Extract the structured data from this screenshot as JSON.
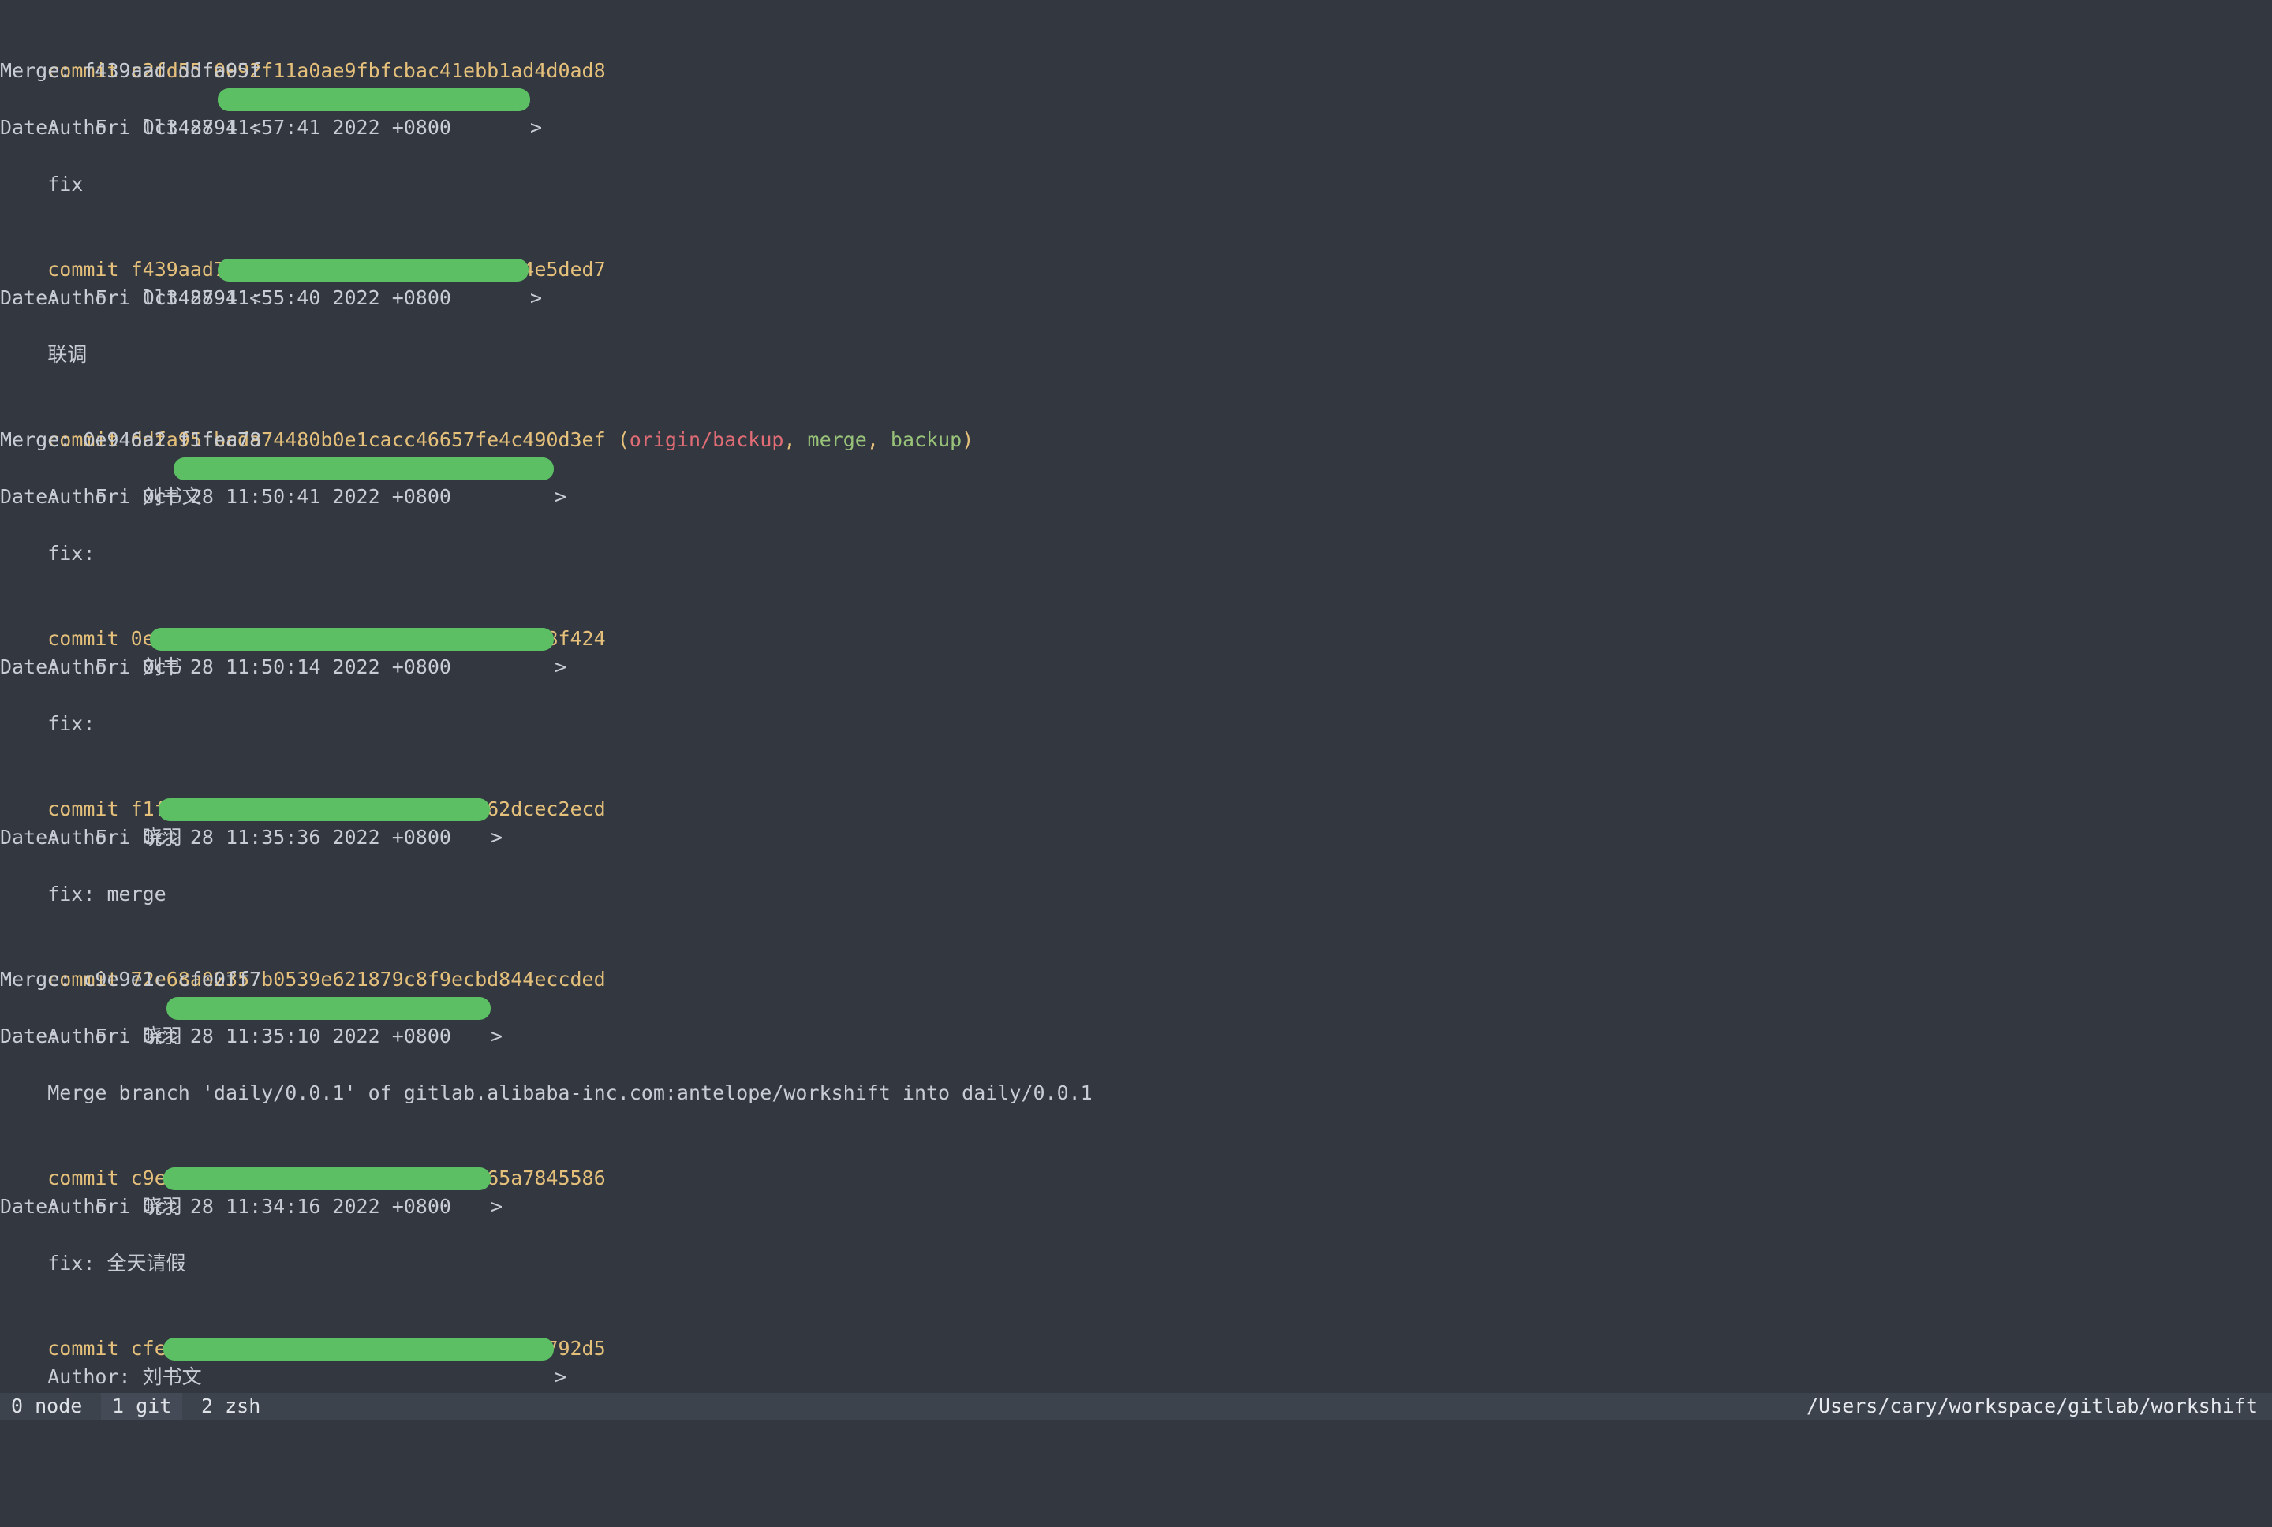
{
  "commits": [
    {
      "commit_label": "commit",
      "hash": "c2fd55f0092f11a0ae9fbfcbac41ebb1ad4d0ad8",
      "merge": "Merge: f439aad ddfa95f",
      "author_prefix": "Author: ll348794 <",
      "date": "Date:   Fri Oct 28 11:57:41 2022 +0800",
      "message": "    fix"
    },
    {
      "commit_label": "commit",
      "hash": "f439aad7fdf8a5069484180f0bc7b0a3e4e5ded7",
      "author_prefix": "Author: ll348794 <",
      "date": "Date:   Fri Oct 28 11:55:40 2022 +0800",
      "message": "    联调"
    },
    {
      "commit_label": "commit",
      "hash": "ddfa95fbcda74480b0e1cacc46657fe4c490d3ef",
      "refs": {
        "open": " (",
        "remote": "origin/backup",
        "sep1": ", ",
        "branch1": "merge",
        "sep2": ", ",
        "branch2": "backup",
        "close": ")"
      },
      "merge": "Merge: 0e946a2 f1fea78",
      "author_prefix": "Author: 刘书文",
      "date": "Date:   Fri Oct 28 11:50:41 2022 +0800",
      "message": "    fix:"
    },
    {
      "commit_label": "commit",
      "hash": "0e946a2bfecbb5ac50e4c6c28aa3119d7a58f424",
      "author_prefix": "Author: 刘书",
      "date": "Date:   Fri Oct 28 11:50:14 2022 +0800",
      "message": "    fix:"
    },
    {
      "commit_label": "commit",
      "hash": "f1fea782cfe6c0dff24164112a674562dcec2ecd",
      "author_prefix": "Author: 晓羽",
      "date": "Date:   Fri Oct 28 11:35:36 2022 +0800",
      "message": "    fix: merge"
    },
    {
      "commit_label": "commit",
      "hash": "72e68a02357b0539e621879c8f9ecbd844eccded",
      "merge": "Merge: c9e9e1c cfe0ff7",
      "author_prefix": "Author: 晓羽",
      "date": "Date:   Fri Oct 28 11:35:10 2022 +0800",
      "message": "    Merge branch 'daily/0.0.1' of gitlab.alibaba-inc.com:antelope/workshift into daily/0.0.1"
    },
    {
      "commit_label": "commit",
      "hash": "c9e9e1c4f6b934aa91303dd4d08cb565a7845586",
      "author_prefix": "Author: 晓羽",
      "date": "Date:   Fri Oct 28 11:34:16 2022 +0800",
      "message": "    fix: 全天请假"
    },
    {
      "commit_label": "commit",
      "hash": "cfe0ff750ed2a5bd2471e7ebf0f9a6ac334792d5",
      "author_prefix": "Author: 刘书文"
    }
  ],
  "email_suffix": ">",
  "pager_prompt": ":",
  "statusbar": {
    "tabs": [
      {
        "label": "0 node",
        "active": false
      },
      {
        "label": "1 git",
        "active": true
      },
      {
        "label": "2 zsh",
        "active": false
      }
    ],
    "path": "/Users/cary/workspace/gitlab/workshift"
  },
  "colors": {
    "background": "#323740",
    "commit_hash": "#e5c07b",
    "remote_ref": "#e06c75",
    "local_branch": "#98c379",
    "redaction": "#5cbf63"
  }
}
